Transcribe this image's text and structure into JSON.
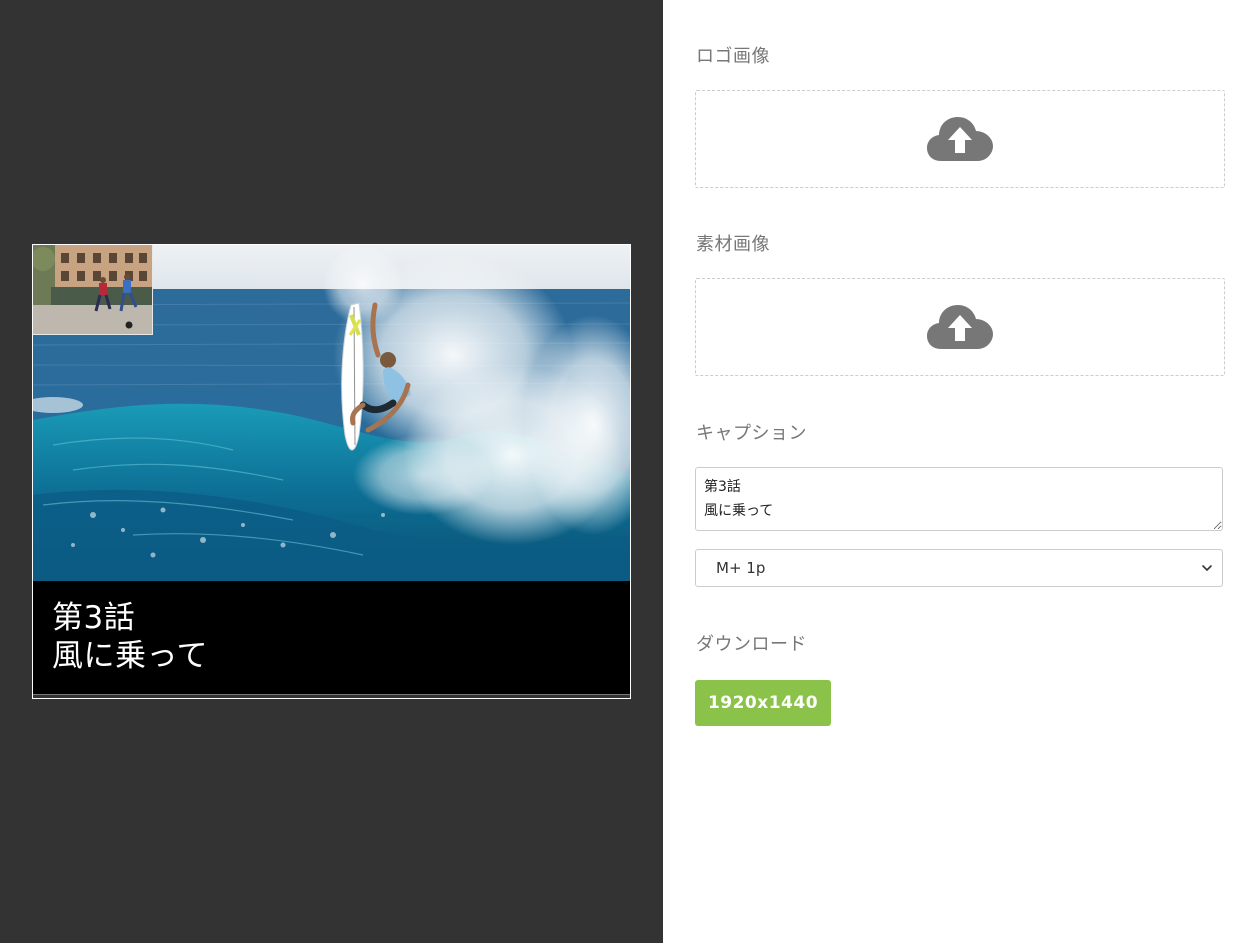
{
  "preview": {
    "caption_line1": "第3話",
    "caption_line2": "風に乗って"
  },
  "controls": {
    "logo_label": "ロゴ画像",
    "material_label": "素材画像",
    "caption_label": "キャプション",
    "caption_value": "第3話\n風に乗って",
    "font_selected": "M+ 1p",
    "download_label": "ダウンロード",
    "download_button": "1920x1440"
  },
  "icons": {
    "upload": "cloud-upload-icon",
    "dropdown": "chevron-down-icon"
  },
  "colors": {
    "preview_bg": "#333333",
    "accent_green": "#8bc34a",
    "label_gray": "#777777",
    "icon_gray": "#777777"
  }
}
